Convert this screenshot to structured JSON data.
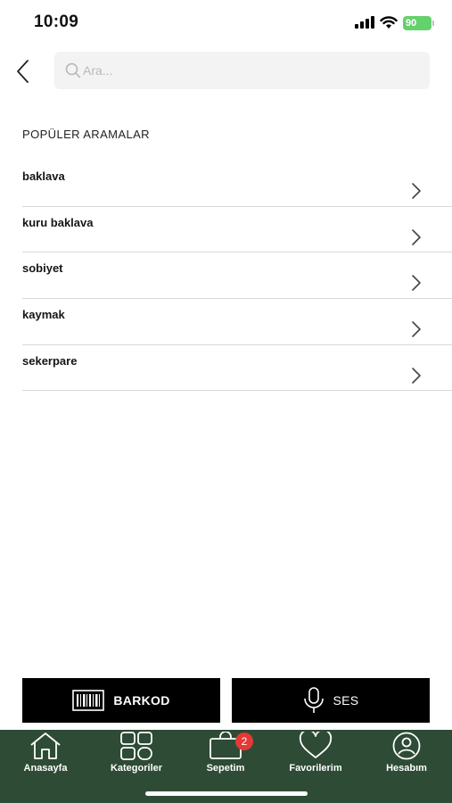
{
  "status_bar": {
    "time": "10:09",
    "battery": "90"
  },
  "search": {
    "placeholder": "Ara..."
  },
  "popular": {
    "title": "POPÜLER ARAMALAR",
    "items": [
      {
        "label": "baklava"
      },
      {
        "label": "kuru baklava"
      },
      {
        "label": "sobiyet"
      },
      {
        "label": "kaymak"
      },
      {
        "label": "sekerpare"
      }
    ]
  },
  "actions": {
    "barcode_label": "BARKOD",
    "voice_label": "SES"
  },
  "tab_bar": {
    "background": "#2d4b35",
    "tabs": [
      {
        "label": "Anasayfa",
        "icon": "home-icon"
      },
      {
        "label": "Kategoriler",
        "icon": "grid-icon"
      },
      {
        "label": "Sepetim",
        "icon": "cart-icon",
        "badge": "2"
      },
      {
        "label": "Favorilerim",
        "icon": "heart-icon"
      },
      {
        "label": "Hesabım",
        "icon": "user-icon"
      }
    ]
  }
}
